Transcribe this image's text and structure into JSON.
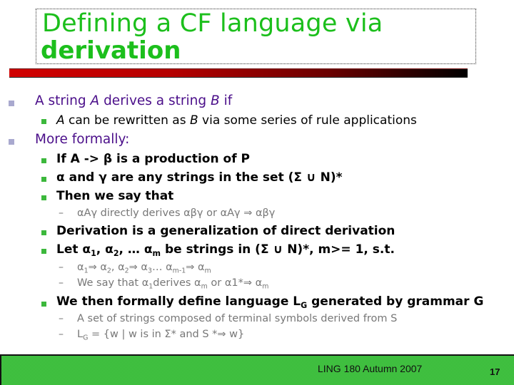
{
  "slide": {
    "title_line1": "Defining a CF language via",
    "title_line2": "derivation",
    "bullets": {
      "b1": "A string ",
      "b1_A": "A",
      "b1_mid": " derives a string ",
      "b1_B": "B",
      "b1_end": " if",
      "b1_1_A": "A",
      "b1_1_mid": " can be rewritten as ",
      "b1_1_B": "B",
      "b1_1_end": " via some series of rule applications",
      "b2": "More formally:",
      "b2_1": "If A -> β is a production of P",
      "b2_2": "α and γ are any strings in the set (Σ ∪ N)*",
      "b2_3": "Then we say that",
      "b2_3_1": "αAγ directly derives αβγ  or αAγ ⇒ αβγ",
      "b2_4": "Derivation is a generalization of direct derivation",
      "b2_5_pre": "Let α",
      "b2_5_s1": "1",
      "b2_5_m1": ", α",
      "b2_5_s2": "2",
      "b2_5_m2": ", … α",
      "b2_5_s3": "m",
      "b2_5_end": " be strings in (Σ ∪ N)*, m>= 1, s.t.",
      "b2_5_1_a": "α",
      "b2_5_1_s1": "1",
      "b2_5_1_b": "⇒ α",
      "b2_5_1_s2": "2",
      "b2_5_1_c": ", α",
      "b2_5_1_s3": "2",
      "b2_5_1_d": "⇒ α",
      "b2_5_1_s4": "3",
      "b2_5_1_e": "… α",
      "b2_5_1_s5": "m-1",
      "b2_5_1_f": "⇒ α",
      "b2_5_1_s6": "m",
      "b2_5_2_a": "We say that α",
      "b2_5_2_s1": "1",
      "b2_5_2_b": "derives α",
      "b2_5_2_s2": "m",
      "b2_5_2_c": " or α1*⇒ α",
      "b2_5_2_s3": "m",
      "b2_6_a": "We then formally define language L",
      "b2_6_s": "G",
      "b2_6_b": " generated by grammar G",
      "b2_6_1": "A set of strings composed of terminal symbols derived from S",
      "b2_6_2_a": "L",
      "b2_6_2_s": "G",
      "b2_6_2_b": " = {w | w is in Σ* and S *⇒ w}"
    }
  },
  "footer": {
    "course": "LING 180 Autumn 2007",
    "page_number": "17"
  },
  "colors": {
    "title": "#1cbf1c",
    "level1_text": "#4b0f8a",
    "level2_bullet": "#3cb83c",
    "level1_bullet": "#a9a9cf",
    "footer_bg": "#4fcf4f"
  }
}
